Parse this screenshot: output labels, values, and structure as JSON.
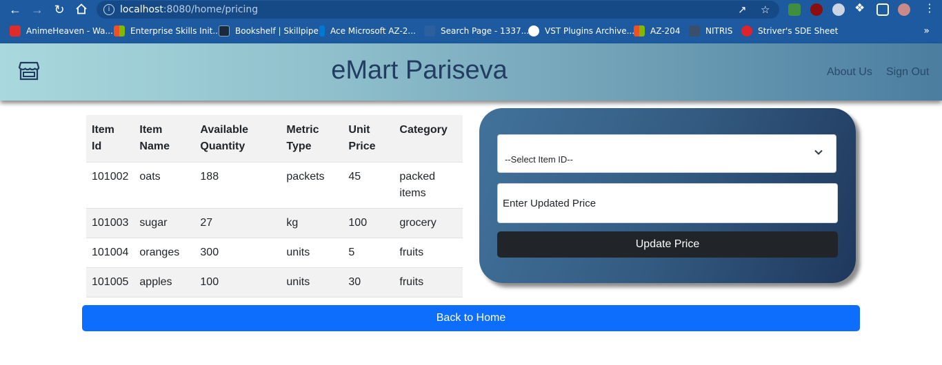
{
  "browser": {
    "url_host": "localhost",
    "url_rest": ":8080/home/pricing",
    "bookmarks": [
      {
        "label": "AnimeHeaven - Wa...",
        "color": "#e02b2b"
      },
      {
        "label": "Enterprise Skills Init...",
        "color": "#f25022"
      },
      {
        "label": "Bookshelf | Skillpipe",
        "color": "#1b2a3a"
      },
      {
        "label": "Ace Microsoft AZ-2...",
        "color": "#0078d4"
      },
      {
        "label": "Search Page - 1337...",
        "color": "#2c5f9e"
      },
      {
        "label": "VST Plugins Archive...",
        "color": "#ffffff"
      },
      {
        "label": "AZ-204",
        "color": "#f25022"
      },
      {
        "label": "NITRIS",
        "color": "#3a4f6b"
      },
      {
        "label": "Striver's SDE Sheet",
        "color": "#e0232b"
      }
    ],
    "more_bookmarks": "»"
  },
  "header": {
    "brand": "eMart Pariseva",
    "nav": {
      "about": "About Us",
      "signout": "Sign Out"
    }
  },
  "table": {
    "headers": {
      "item_id": [
        "Item",
        "Id"
      ],
      "item_name": [
        "Item",
        "Name"
      ],
      "available_quantity": [
        "Available",
        "Quantity"
      ],
      "metric_type": [
        "Metric",
        "Type"
      ],
      "unit_price": [
        "Unit",
        "Price"
      ],
      "category": "Category"
    },
    "rows": [
      {
        "item_id": "101002",
        "item_name": "oats",
        "quantity": "188",
        "metric": "packets",
        "price": "45",
        "category": [
          "packed",
          "items"
        ]
      },
      {
        "item_id": "101003",
        "item_name": "sugar",
        "quantity": "27",
        "metric": "kg",
        "price": "100",
        "category": [
          "grocery"
        ]
      },
      {
        "item_id": "101004",
        "item_name": "oranges",
        "quantity": "300",
        "metric": "units",
        "price": "5",
        "category": [
          "fruits"
        ]
      },
      {
        "item_id": "101005",
        "item_name": "apples",
        "quantity": "100",
        "metric": "units",
        "price": "30",
        "category": [
          "fruits"
        ]
      }
    ]
  },
  "form": {
    "select_value": "--Select Item ID--",
    "price_placeholder": "Enter Updated Price",
    "submit_label": "Update Price"
  },
  "back_label": "Back to Home"
}
